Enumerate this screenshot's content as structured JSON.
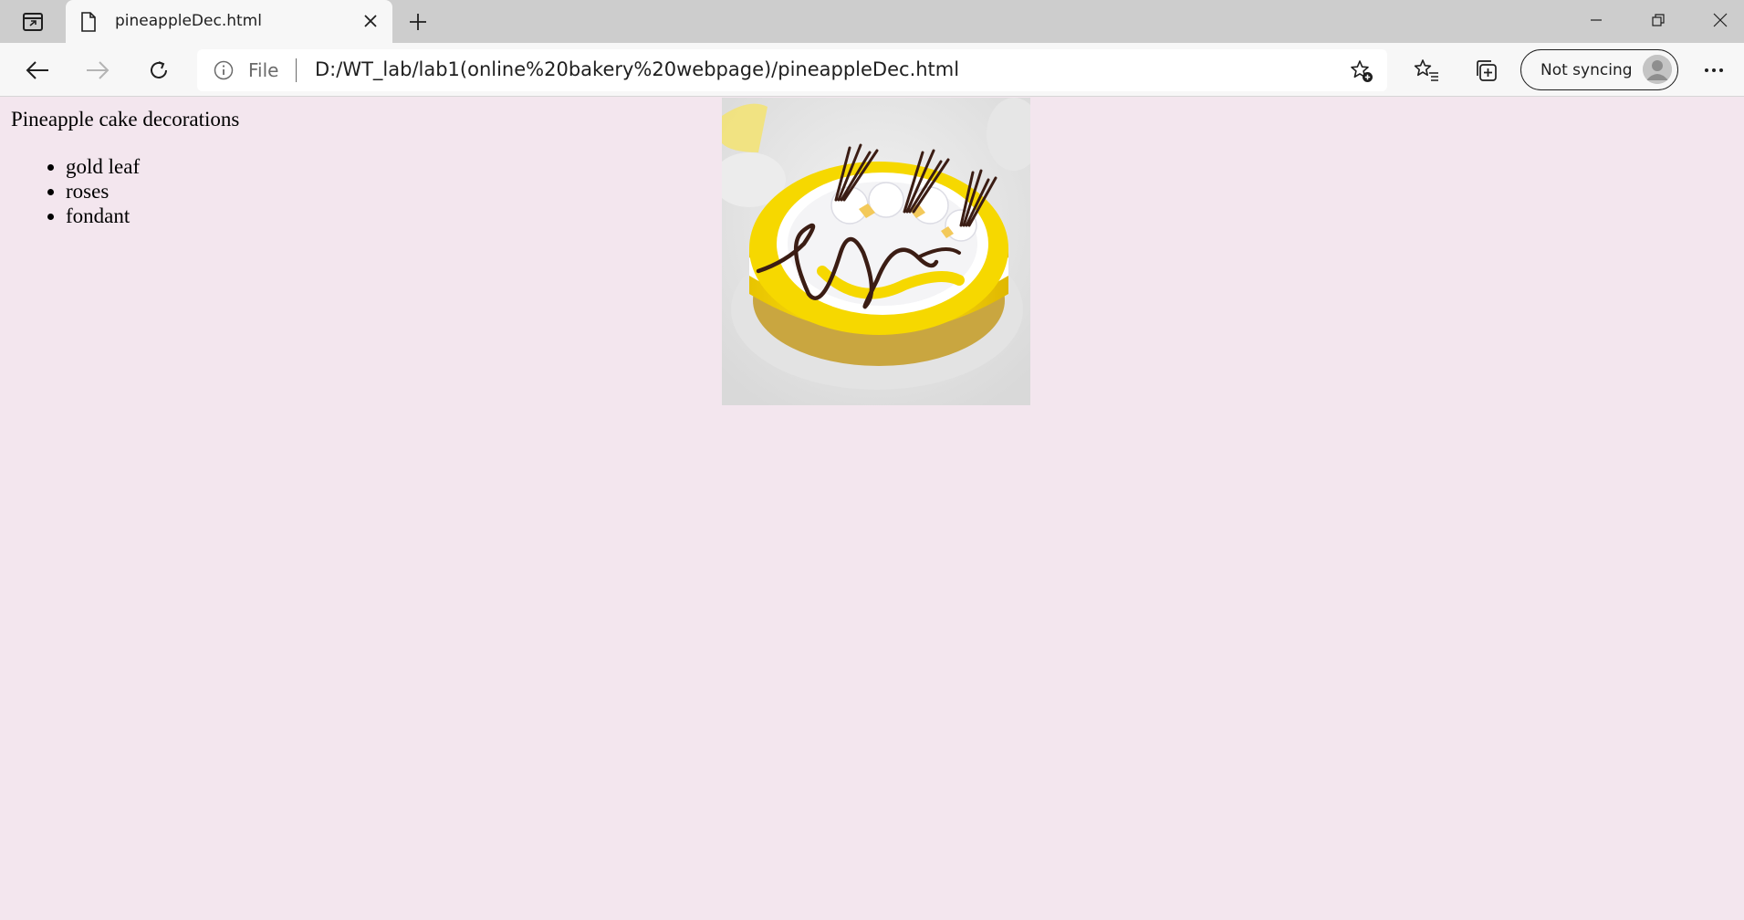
{
  "browser": {
    "tab_title": "pineappleDec.html",
    "address_scheme": "File",
    "address_url": "D:/WT_lab/lab1(online%20bakery%20webpage)/pineappleDec.html",
    "sync_label": "Not syncing",
    "icons": [
      "tab-actions-icon",
      "file-icon",
      "close-icon",
      "plus-icon",
      "minimize-icon",
      "restore-icon",
      "close-window-icon",
      "back-arrow-icon",
      "forward-arrow-icon",
      "refresh-icon",
      "info-icon",
      "add-favorite-icon",
      "favorites-icon",
      "collections-icon",
      "profile-avatar-icon",
      "more-icon"
    ]
  },
  "page": {
    "heading": "Pineapple cake decorations",
    "decorations": [
      "gold leaf",
      "roses",
      "fondant"
    ],
    "image_subject": "pineapple cake with yellow rim, white cream rosettes and chocolate swirl decorations"
  },
  "colors": {
    "page_background": "#f3e6ee",
    "tabstrip": "#cdcdcd",
    "toolbar": "#f7f7f7",
    "cake_yellow": "#f6d800",
    "chocolate": "#3b1d14"
  }
}
